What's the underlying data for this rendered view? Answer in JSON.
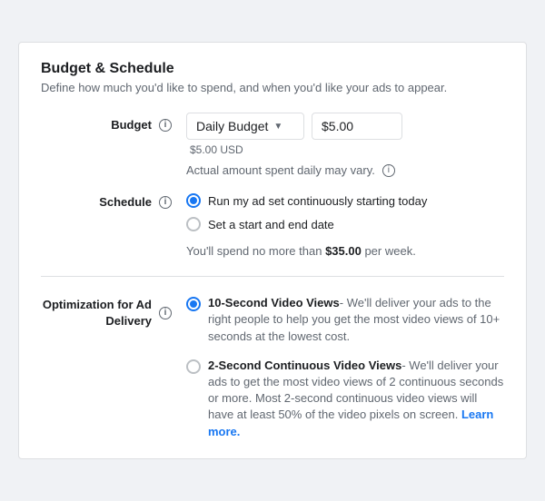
{
  "header": {
    "title": "Budget & Schedule",
    "subtitle": "Define how much you'd like to spend, and when you'd like your ads to appear."
  },
  "budget": {
    "label": "Budget",
    "dropdown_value": "Daily Budget",
    "amount": "$5.00",
    "currency_note": "$5.00 USD",
    "amount_note": "Actual amount spent daily may vary."
  },
  "schedule": {
    "label": "Schedule",
    "options": [
      {
        "id": "continuous",
        "label": "Run my ad set continuously starting today",
        "selected": true
      },
      {
        "id": "start_end",
        "label": "Set a start and end date",
        "selected": false
      }
    ],
    "weekly_note_prefix": "You'll spend no more than ",
    "weekly_amount": "$35.00",
    "weekly_note_suffix": " per week."
  },
  "optimization": {
    "label": "Optimization for Ad Delivery",
    "options": [
      {
        "id": "10sec",
        "selected": true,
        "title": "10-Second Video Views",
        "description": "- We'll deliver your ads to the right people to help you get the most video views of 10+ seconds at the lowest cost."
      },
      {
        "id": "2sec",
        "selected": false,
        "title": "2-Second Continuous Video Views",
        "description": "- We'll deliver your ads to get the most video views of 2 continuous seconds or more. Most 2-second continuous video views will have at least 50% of the video pixels on screen.",
        "learn_more_text": "Learn more.",
        "learn_more_href": "#"
      }
    ]
  }
}
